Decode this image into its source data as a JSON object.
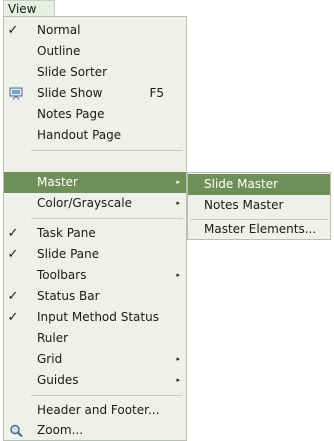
{
  "menubar": {
    "title": "View"
  },
  "menu": {
    "items": [
      {
        "label": "Normal",
        "checked": true
      },
      {
        "label": "Outline"
      },
      {
        "label": "Slide Sorter"
      },
      {
        "label": "Slide Show",
        "accelerator": "F5",
        "icon": "slideshow-icon"
      },
      {
        "label": "Notes Page"
      },
      {
        "label": "Handout Page"
      },
      {
        "label": "Master",
        "submenu": true,
        "highlighted": true
      },
      {
        "label": "Color/Grayscale",
        "submenu": true
      },
      {
        "label": "Task Pane",
        "checked": true
      },
      {
        "label": "Slide Pane",
        "checked": true
      },
      {
        "label": "Toolbars",
        "submenu": true
      },
      {
        "label": "Status Bar",
        "checked": true
      },
      {
        "label": "Input Method Status",
        "checked": true
      },
      {
        "label": "Ruler"
      },
      {
        "label": "Grid",
        "submenu": true
      },
      {
        "label": "Guides",
        "submenu": true
      },
      {
        "label": "Header and Footer..."
      },
      {
        "label": "Zoom...",
        "icon": "zoom-icon"
      }
    ],
    "checkmark_glyph": "✓",
    "submenu_arrow_glyph": "▸"
  },
  "submenu": {
    "items": [
      {
        "label": "Slide Master",
        "highlighted": true
      },
      {
        "label": "Notes Master"
      },
      {
        "label": "Master Elements..."
      }
    ]
  },
  "colors": {
    "highlight": "#6f8f58",
    "menu_bg": "#eef0ea"
  }
}
